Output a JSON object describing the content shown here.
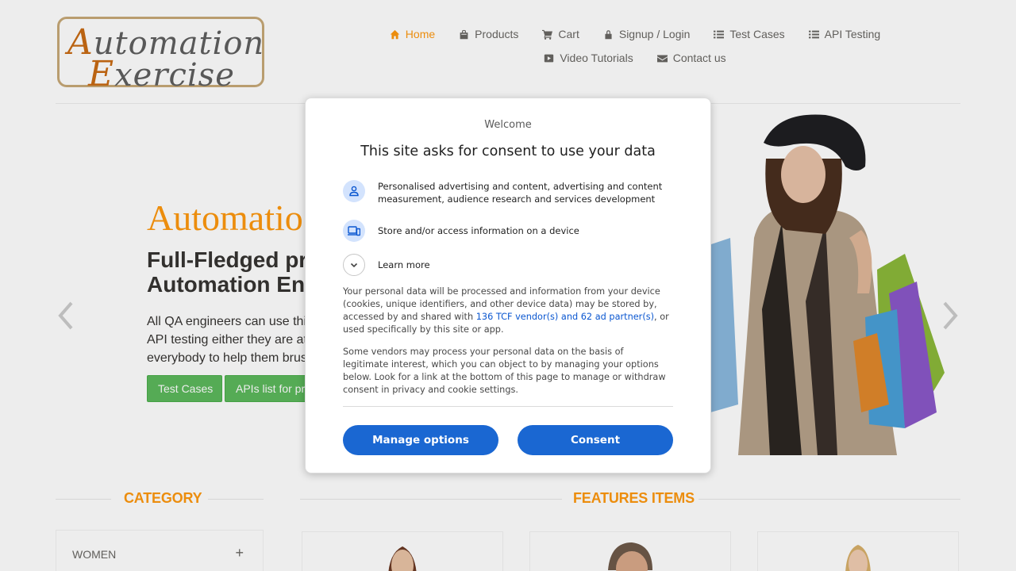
{
  "logo": {
    "line1_cap": "A",
    "line1_rest": "utomation",
    "line2_cap": "E",
    "line2_rest": "xercise"
  },
  "nav": {
    "row1": [
      {
        "label": "Home",
        "icon": "home-icon",
        "active": true
      },
      {
        "label": "Products",
        "icon": "products-icon"
      },
      {
        "label": "Cart",
        "icon": "cart-icon"
      },
      {
        "label": "Signup / Login",
        "icon": "lock-icon"
      },
      {
        "label": "Test Cases",
        "icon": "list-icon"
      },
      {
        "label": "API Testing",
        "icon": "list-icon"
      }
    ],
    "row2": [
      {
        "label": "Video Tutorials",
        "icon": "youtube-icon"
      },
      {
        "label": "Contact us",
        "icon": "envelope-icon"
      }
    ]
  },
  "slider": {
    "title": "Automatio",
    "subtitle_line1": "Full-Fledged pra",
    "subtitle_line2": "Automation Eng",
    "text_line1": "All QA engineers can use thi",
    "text_line2": "API testing either they are at",
    "text_line3": "everybody to help them brus",
    "button_test_cases": "Test Cases",
    "button_apis": "APIs list for pr"
  },
  "sections": {
    "category": "CATEGORY",
    "features": "FEATURES ITEMS"
  },
  "category_items": [
    {
      "label": "WOMEN",
      "toggle": "+"
    }
  ],
  "consent": {
    "welcome": "Welcome",
    "heading": "This site asks for consent to use your data",
    "purpose1": "Personalised advertising and content, advertising and content measurement, audience research and services development",
    "purpose2": "Store and/or access information on a device",
    "learn_more": "Learn more",
    "para1_before": "Your personal data will be processed and information from your device (cookies, unique identifiers, and other device data) may be stored by, accessed by and shared with ",
    "para1_link": "136 TCF vendor(s) and 62 ad partner(s)",
    "para1_after": ", or used specifically by this site or app.",
    "para2": "Some vendors may process your personal data on the basis of legitimate interest, which you can object to by managing your options below. Look for a link at the bottom of this page to manage or withdraw consent in privacy and cookie settings.",
    "manage_options": "Manage options",
    "consent_button": "Consent"
  },
  "colors": {
    "accent": "#fe980f",
    "button_blue": "#1a67d2",
    "green": "#5cb85c"
  }
}
